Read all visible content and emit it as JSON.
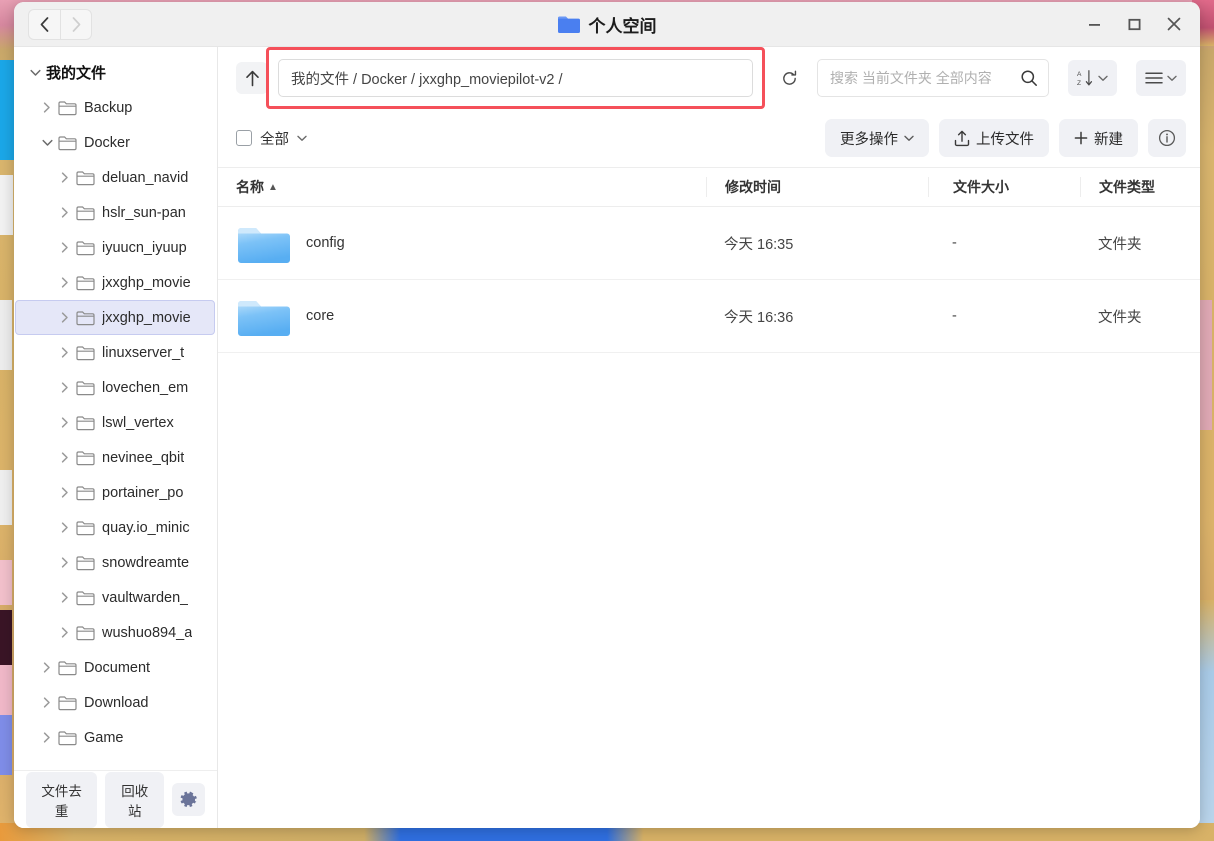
{
  "window": {
    "title": "个人空间",
    "title_icon": "folder-icon",
    "controls": {
      "minimize": "minimize-icon",
      "maximize": "maximize-icon",
      "close": "close-icon"
    },
    "nav": {
      "back": "chevron-left-icon",
      "forward": "chevron-right-icon"
    }
  },
  "pathbar": {
    "up_icon": "arrow-up-icon",
    "path_value": "我的文件 / Docker / jxxghp_moviepilot-v2 /",
    "path_placeholder": "",
    "refresh_icon": "refresh-icon",
    "highlight_color": "#f5505a",
    "search": {
      "value": "",
      "placeholder": "搜索 当前文件夹 全部内容",
      "icon": "search-icon"
    },
    "sort_button": {
      "icon": "sort-az-icon",
      "chevron": "chevron-down-icon"
    },
    "view_button": {
      "icon": "list-view-icon",
      "chevron": "chevron-down-icon"
    }
  },
  "actionbar": {
    "select_all_label": "全部",
    "select_all_chevron": "chevron-down-icon",
    "more_actions": {
      "label": "更多操作",
      "chevron": "chevron-down-icon"
    },
    "upload": {
      "label": "上传文件",
      "icon": "upload-icon"
    },
    "new": {
      "label": "新建",
      "icon": "plus-icon"
    },
    "info": {
      "icon": "info-icon"
    }
  },
  "sidebar": {
    "items": [
      {
        "label": "我的文件",
        "level": 0,
        "expanded": true,
        "selected": false,
        "has_folder_icon": false
      },
      {
        "label": "Backup",
        "level": 1,
        "expanded": false,
        "selected": false,
        "has_folder_icon": true
      },
      {
        "label": "Docker",
        "level": 1,
        "expanded": true,
        "selected": false,
        "has_folder_icon": true
      },
      {
        "label": "deluan_navid",
        "level": 2,
        "expanded": false,
        "selected": false,
        "has_folder_icon": true
      },
      {
        "label": "hslr_sun-pan",
        "level": 2,
        "expanded": false,
        "selected": false,
        "has_folder_icon": true
      },
      {
        "label": "iyuucn_iyuup",
        "level": 2,
        "expanded": false,
        "selected": false,
        "has_folder_icon": true
      },
      {
        "label": "jxxghp_movie",
        "level": 2,
        "expanded": false,
        "selected": false,
        "has_folder_icon": true
      },
      {
        "label": "jxxghp_movie",
        "level": 2,
        "expanded": false,
        "selected": true,
        "has_folder_icon": true
      },
      {
        "label": "linuxserver_t",
        "level": 2,
        "expanded": false,
        "selected": false,
        "has_folder_icon": true
      },
      {
        "label": "lovechen_em",
        "level": 2,
        "expanded": false,
        "selected": false,
        "has_folder_icon": true
      },
      {
        "label": "lswl_vertex",
        "level": 2,
        "expanded": false,
        "selected": false,
        "has_folder_icon": true
      },
      {
        "label": "nevinee_qbit",
        "level": 2,
        "expanded": false,
        "selected": false,
        "has_folder_icon": true
      },
      {
        "label": "portainer_po",
        "level": 2,
        "expanded": false,
        "selected": false,
        "has_folder_icon": true
      },
      {
        "label": "quay.io_minic",
        "level": 2,
        "expanded": false,
        "selected": false,
        "has_folder_icon": true
      },
      {
        "label": "snowdreamte",
        "level": 2,
        "expanded": false,
        "selected": false,
        "has_folder_icon": true
      },
      {
        "label": "vaultwarden_",
        "level": 2,
        "expanded": false,
        "selected": false,
        "has_folder_icon": true
      },
      {
        "label": "wushuo894_a",
        "level": 2,
        "expanded": false,
        "selected": false,
        "has_folder_icon": true
      },
      {
        "label": "Document",
        "level": 1,
        "expanded": false,
        "selected": false,
        "has_folder_icon": true
      },
      {
        "label": "Download",
        "level": 1,
        "expanded": false,
        "selected": false,
        "has_folder_icon": true
      },
      {
        "label": "Game",
        "level": 1,
        "expanded": false,
        "selected": false,
        "has_folder_icon": true
      }
    ],
    "footer": {
      "dedupe_label": "文件去重",
      "recycle_label": "回收站",
      "settings_icon": "gear-icon"
    }
  },
  "table": {
    "columns": [
      {
        "label": "名称",
        "sort_indicator": "▲"
      },
      {
        "label": "修改时间",
        "sort_indicator": ""
      },
      {
        "label": "文件大小",
        "sort_indicator": ""
      },
      {
        "label": "文件类型",
        "sort_indicator": ""
      }
    ],
    "rows": [
      {
        "name": "config",
        "modified": "今天 16:35",
        "size": "-",
        "type": "文件夹",
        "icon": "folder-icon"
      },
      {
        "name": "core",
        "modified": "今天 16:36",
        "size": "-",
        "type": "文件夹",
        "icon": "folder-icon"
      }
    ]
  }
}
